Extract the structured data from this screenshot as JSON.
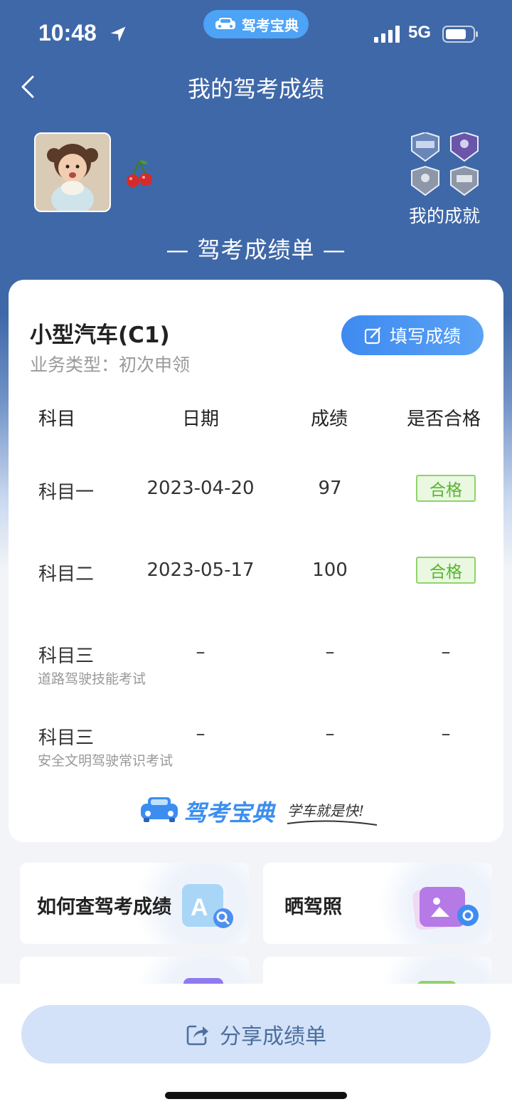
{
  "status_bar": {
    "time": "10:48",
    "network": "5G",
    "app_pill": "驾考宝典"
  },
  "nav": {
    "title": "我的驾考成绩"
  },
  "profile": {
    "achievements_label": "我的成就"
  },
  "report": {
    "title": "— 驾考成绩单 —"
  },
  "card": {
    "vehicle_type": "小型汽车(C1)",
    "business_type": "业务类型：初次申领",
    "fill_button": "填写成绩",
    "headers": [
      "科目",
      "日期",
      "成绩",
      "是否合格"
    ],
    "rows": [
      {
        "subject": "科目一",
        "sub_label": "",
        "date": "2023-04-20",
        "score": "97",
        "status": "合格"
      },
      {
        "subject": "科目二",
        "sub_label": "",
        "date": "2023-05-17",
        "score": "100",
        "status": "合格"
      },
      {
        "subject": "科目三",
        "sub_label": "道路驾驶技能考试",
        "date": "–",
        "score": "–",
        "status": "–"
      },
      {
        "subject": "科目三",
        "sub_label": "安全文明驾驶常识考试",
        "date": "–",
        "score": "–",
        "status": "–"
      }
    ],
    "brand": "驾考宝典",
    "slogan": "学车就是快!"
  },
  "tiles": [
    {
      "label": "如何查驾考成绩"
    },
    {
      "label": "晒驾照"
    }
  ],
  "share_button": "分享成绩单",
  "colors": {
    "header_blue": "#3f68a8",
    "accent": "#3e8af0",
    "pass_green": "#56b52d"
  }
}
